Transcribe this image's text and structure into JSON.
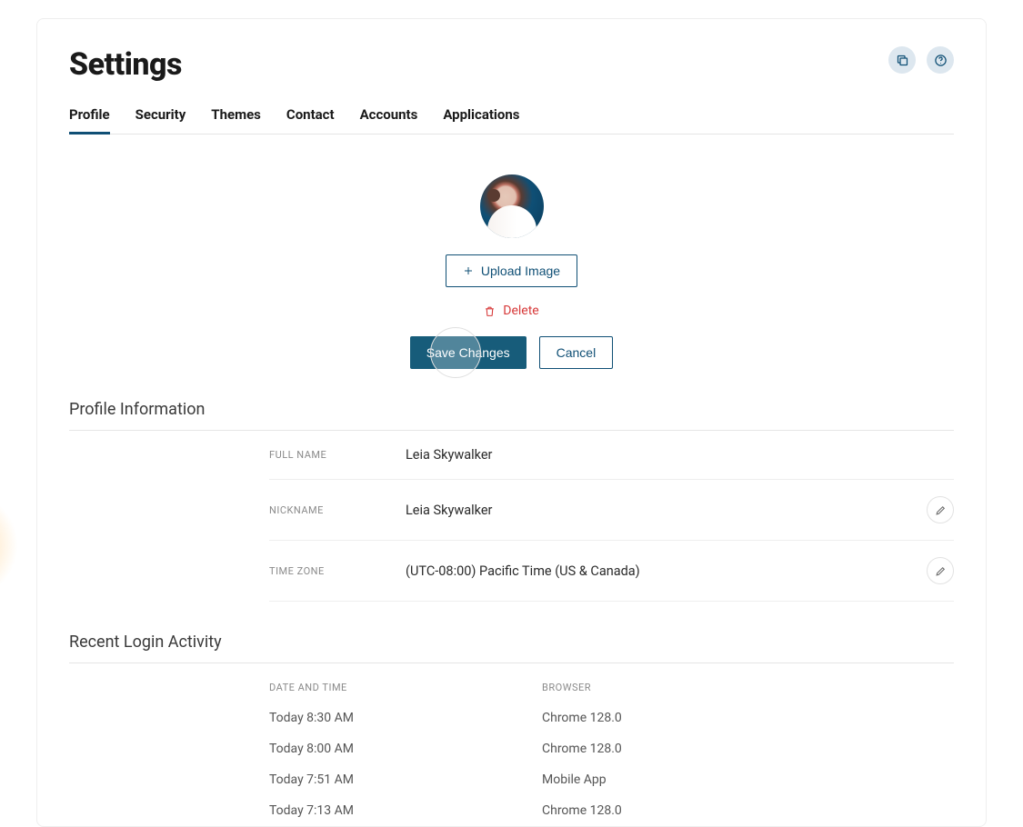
{
  "header": {
    "title": "Settings"
  },
  "tabs": {
    "items": [
      {
        "label": "Profile",
        "active": true
      },
      {
        "label": "Security",
        "active": false
      },
      {
        "label": "Themes",
        "active": false
      },
      {
        "label": "Contact",
        "active": false
      },
      {
        "label": "Accounts",
        "active": false
      },
      {
        "label": "Applications",
        "active": false
      }
    ]
  },
  "avatar": {
    "upload_label": "Upload Image",
    "delete_label": "Delete"
  },
  "actions": {
    "save_label": "Save Changes",
    "cancel_label": "Cancel"
  },
  "profile_section": {
    "title": "Profile Information",
    "rows": [
      {
        "label": "FULL NAME",
        "value": "Leia Skywalker",
        "editable": false
      },
      {
        "label": "NICKNAME",
        "value": "Leia Skywalker",
        "editable": true
      },
      {
        "label": "TIME ZONE",
        "value": "(UTC-08:00) Pacific Time (US & Canada)",
        "editable": true
      }
    ]
  },
  "login_section": {
    "title": "Recent Login Activity",
    "col_time": "DATE AND TIME",
    "col_browser": "BROWSER",
    "rows": [
      {
        "time": "Today 8:30 AM",
        "browser": "Chrome 128.0"
      },
      {
        "time": "Today 8:00 AM",
        "browser": "Chrome 128.0"
      },
      {
        "time": "Today 7:51 AM",
        "browser": "Mobile App"
      },
      {
        "time": "Today 7:13 AM",
        "browser": "Chrome 128.0"
      }
    ]
  },
  "icons": {
    "copy": "copy-icon",
    "help": "help-icon",
    "plus": "plus-icon",
    "trash": "trash-icon",
    "pencil": "pencil-icon"
  }
}
